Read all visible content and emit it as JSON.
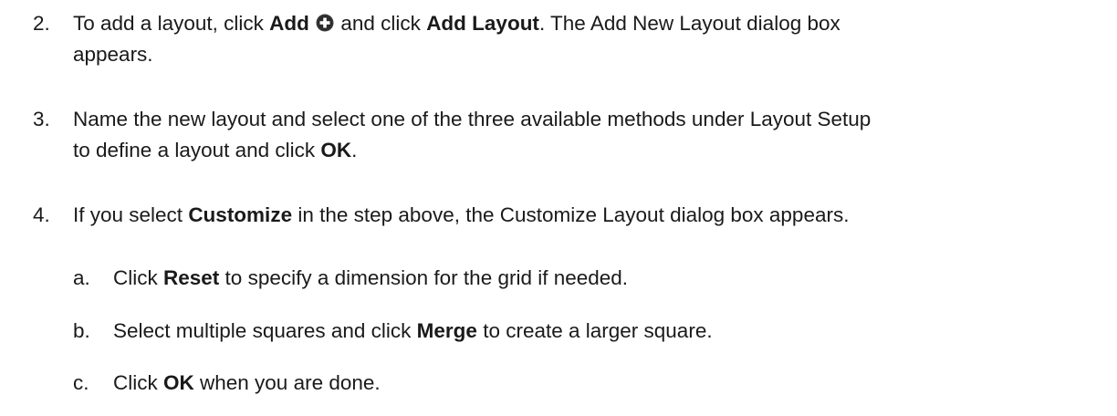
{
  "steps": [
    {
      "number": "2.",
      "parts": [
        {
          "t": "To add a layout, click "
        },
        {
          "b": "Add"
        },
        {
          "icon": "add-circle-icon"
        },
        {
          "t": " and click "
        },
        {
          "b": "Add Layout"
        },
        {
          "t": ". The Add New Layout dialog box"
        }
      ],
      "continuation": "appears."
    },
    {
      "number": "3.",
      "line1": "Name the new layout and select one of the three available methods under Layout Setup",
      "line2_pre": "to define a layout and click ",
      "line2_bold": "OK",
      "line2_post": "."
    },
    {
      "number": "4.",
      "pre": "If you select ",
      "bold": "Customize",
      "post": " in the step above, the Customize Layout dialog box appears."
    }
  ],
  "substeps": [
    {
      "letter": "a.",
      "pre": "Click ",
      "bold": "Reset",
      "post": " to specify a dimension for the grid if needed."
    },
    {
      "letter": "b.",
      "pre": "Select multiple squares and click ",
      "bold": "Merge",
      "post": " to create a larger square."
    },
    {
      "letter": "c.",
      "pre": "Click ",
      "bold": "OK",
      "post": " when you are done."
    }
  ]
}
